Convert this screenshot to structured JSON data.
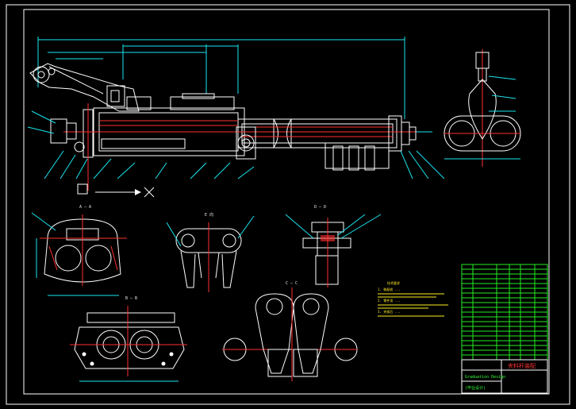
{
  "drawing": {
    "sheet_frame_color": "#ffffff",
    "line_colors": {
      "outline": "#ffffff",
      "dimension": "#19e6f0",
      "center": "#ff3030",
      "table": "#22ee22",
      "note": "#ffee22"
    }
  },
  "section_labels": {
    "aa": "A — A",
    "bb": "B — B",
    "cc": "C — C",
    "dd": "D — D",
    "view_e": "E 向"
  },
  "title_block": {
    "title": "夹料杆装配",
    "subtitle1": "Graduation Design",
    "subtitle2": "(毕业设计)"
  },
  "notes": {
    "heading": "技术要求",
    "lines": [
      "1. 装配前 ...",
      "2. 零件须 ...",
      "3. 夹紧后 ..."
    ]
  }
}
